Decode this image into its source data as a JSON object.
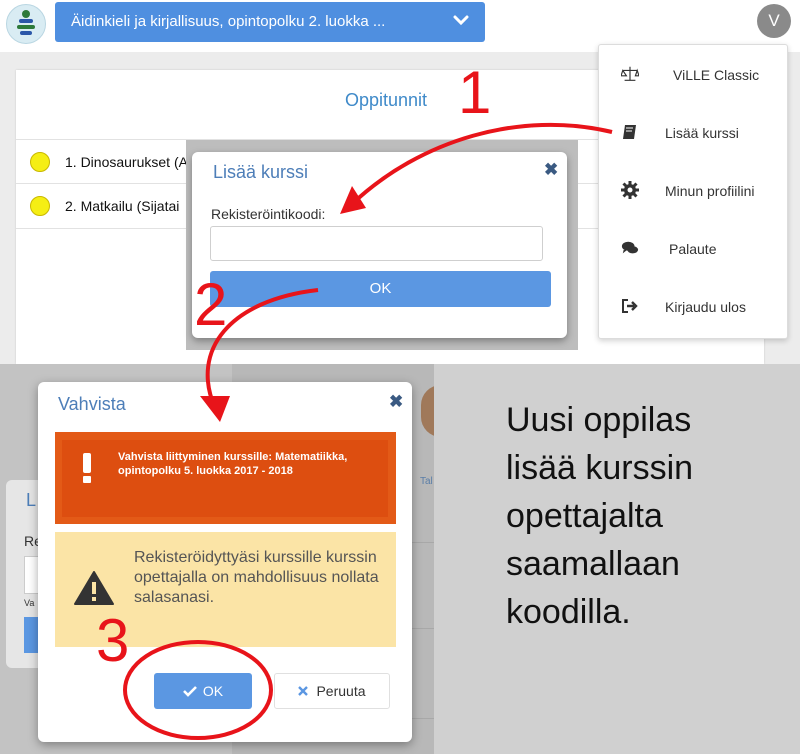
{
  "header": {
    "course_selector": "Äidinkieli ja kirjallisuus, opintopolku 2. luokka ...",
    "avatar_initial": "V"
  },
  "panel": {
    "title": "Oppitunnit",
    "rows": [
      {
        "label": "1. Dinosaurukset (A"
      },
      {
        "label": "2. Matkailu (Sijatai"
      }
    ]
  },
  "user_menu": {
    "items": [
      {
        "label": "ViLLE Classic",
        "icon": "balance-scale-icon"
      },
      {
        "label": "Lisää kurssi",
        "icon": "book-icon"
      },
      {
        "label": "Minun profiilini",
        "icon": "gear-icon"
      },
      {
        "label": "Palaute",
        "icon": "comments-icon"
      },
      {
        "label": "Kirjaudu ulos",
        "icon": "sign-out-icon"
      }
    ]
  },
  "add_course_dialog": {
    "title": "Lisää kurssi",
    "close": "✖",
    "field_label": "Rekisteröintikoodi:",
    "input_value": "",
    "ok_label": "OK"
  },
  "confirm_dialog": {
    "title": "Vahvista",
    "close": "✖",
    "alert_text": "Vahvista liittyminen kurssille: Matematiikka, opintopolku 5. luokka 2017 - 2018",
    "warning_text": "Rekisteröidyttyäsi kurssille kurssin opettajalla on mahdollisuus nollata salasanasi.",
    "ok_label": "OK",
    "cancel_label": "Peruuta"
  },
  "background_fragments": {
    "title_fragment": "L",
    "label_fragment": "Re",
    "small_fragment": "Va",
    "side_fragment": "Tal"
  },
  "annotations": {
    "step1": "1",
    "step2": "2",
    "step3": "3",
    "arrow_color": "#e8141a"
  },
  "caption": {
    "line1": "Uusi oppilas",
    "line2": "lisää kurssin",
    "line3": "opettajalta",
    "line4": "saamallaan",
    "line5": "koodilla."
  },
  "colors": {
    "primary_button": "#5b97e2",
    "alert_orange": "#dd4e10",
    "warning_yellow": "#fbe4a6",
    "title_blue": "#3f8ac9"
  }
}
